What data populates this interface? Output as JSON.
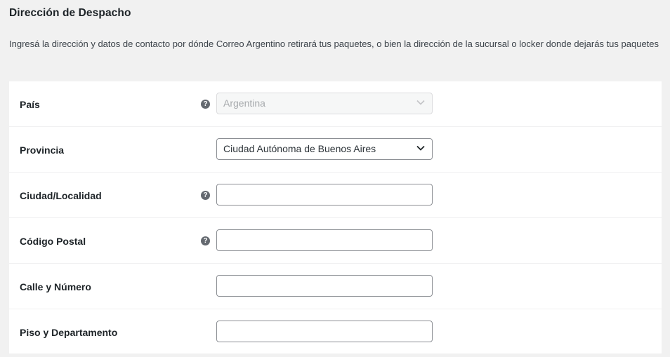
{
  "section": {
    "title": "Dirección de Despacho",
    "description": "Ingresá la dirección y datos de contacto por dónde Correo Argentino retirará tus paquetes, o bien la dirección de la sucursal o locker donde dejarás tus paquetes"
  },
  "fields": {
    "pais": {
      "label": "País",
      "value": "Argentina",
      "help_icon": "question-circle-icon"
    },
    "provincia": {
      "label": "Provincia",
      "value": "Ciudad Autónoma de Buenos Aires"
    },
    "ciudad": {
      "label": "Ciudad/Localidad",
      "value": "",
      "help_icon": "question-circle-icon"
    },
    "codigo_postal": {
      "label": "Código Postal",
      "value": "",
      "help_icon": "question-circle-icon"
    },
    "calle": {
      "label": "Calle y Número",
      "value": ""
    },
    "piso": {
      "label": "Piso y Departamento",
      "value": ""
    }
  },
  "glyphs": {
    "help": "?"
  }
}
